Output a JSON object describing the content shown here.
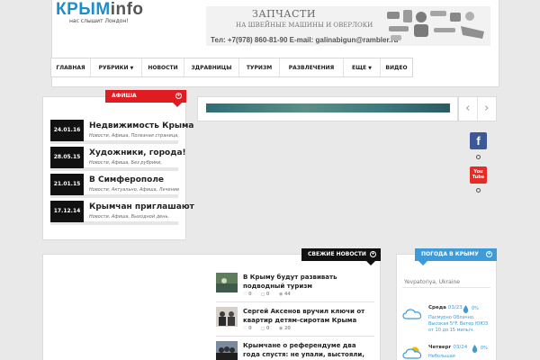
{
  "site": {
    "logo_primary": "КРЫМ",
    "logo_secondary": "info",
    "tagline": "нас слышит Лондон!"
  },
  "ad": {
    "line1": "ЗАПЧАСТИ",
    "line2": "НА ШВЕЙНЫЕ МАШИНЫ И ОВЕРЛОКИ",
    "contact": "Тел: +7(978) 860-81-90 E-mail: galinabigun@rambler.ru"
  },
  "nav": {
    "items": [
      {
        "label": "ГЛАВНАЯ",
        "dropdown": false
      },
      {
        "label": "РУБРИКИ",
        "dropdown": true
      },
      {
        "label": "НОВОСТИ",
        "dropdown": false
      },
      {
        "label": "ЗДРАВНИЦЫ",
        "dropdown": false
      },
      {
        "label": "ТУРИЗМ",
        "dropdown": false
      },
      {
        "label": "РАЗВЛЕЧЕНИЯ",
        "dropdown": false
      },
      {
        "label": "ЕЩЕ",
        "dropdown": true
      },
      {
        "label": "ВИДЕО",
        "dropdown": false
      }
    ]
  },
  "afisha": {
    "tab_label": "АФИША",
    "events": [
      {
        "date": "24.01.16",
        "title": "Недвижимость Крыма",
        "meta": "Новости, Афиша, Полезная страница,"
      },
      {
        "date": "28.05.15",
        "title": "Художники, города!",
        "meta": "Новости, Афиша, Без рубрики,"
      },
      {
        "date": "21.01.15",
        "title": "В Симферополе",
        "meta": "Новости, Актуально, Афиша, Лечение"
      },
      {
        "date": "17.12.14",
        "title": "Крымчан приглашают",
        "meta": "Новости, Афиша, Выходной день,"
      }
    ]
  },
  "slider": {
    "prev_icon": "chevron-left-icon",
    "next_icon": "chevron-right-icon"
  },
  "social": {
    "facebook": "f",
    "youtube_top": "You",
    "youtube_bottom": "Tube"
  },
  "news": {
    "tab_label": "СВЕЖИЕ НОВОСТИ",
    "items": [
      {
        "title": "В Крыму будут развивать подводный туризм",
        "likes": "0",
        "comments": "0",
        "views": "44"
      },
      {
        "title": "Сергей Аксенов вручил ключи от квартир детям-сиротам Крыма",
        "likes": "0",
        "comments": "0",
        "views": "20"
      },
      {
        "title": "Крымчане о референдуме два года спустя: не упали, выстояли, прорвались!",
        "likes": "",
        "comments": "",
        "views": ""
      }
    ]
  },
  "weather": {
    "tab_label": "ПОГОДА В КРЫМУ",
    "location": "Yevpatoriya, Ukraine",
    "days": [
      {
        "day": "Среда",
        "date": "03/23",
        "precip": "0%",
        "desc": "Пасмурно Облачно. Высокая 5°F. Ветер ЮЮЗ от 10 до 15 миль/ч."
      },
      {
        "day": "Четверг",
        "date": "03/24",
        "precip": "0%",
        "desc": "Небольшая"
      }
    ]
  },
  "colors": {
    "brand_blue": "#1c8dcf",
    "afisha_red": "#e11b22",
    "weather_blue": "#3d9bd8",
    "facebook": "#3b5998",
    "youtube": "#e52d27"
  }
}
